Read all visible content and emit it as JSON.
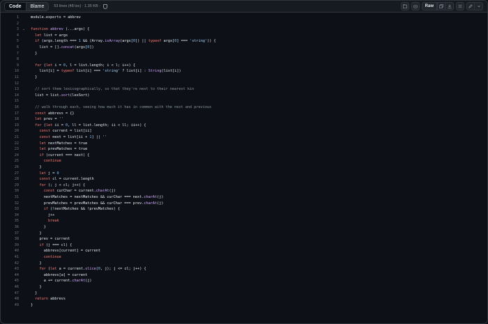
{
  "toolbar": {
    "tab_code": "Code",
    "tab_blame": "Blame",
    "file_info": "53 lines (48 loc) · 1.35 KB ·",
    "raw_label": "Raw"
  },
  "colors": {
    "background": "#0d1117",
    "keyword": "#ff7b72",
    "function": "#d2a8ff",
    "string": "#a5d6ff",
    "number": "#79c0ff",
    "comment": "#8b949e"
  },
  "icons": [
    "shield-icon",
    "copy-path-icon",
    "copilot-icon",
    "copy-icon",
    "download-icon",
    "list-icon",
    "pencil-icon",
    "chevron-down-icon",
    "chevron-fold-icon"
  ],
  "lines": [
    {
      "n": "1",
      "code": "module.exports = abbrev"
    },
    {
      "n": "2",
      "code": ""
    },
    {
      "n": "3",
      "code": "function abbrev (...args) {",
      "fold": true
    },
    {
      "n": "4",
      "code": "  let list = args"
    },
    {
      "n": "5",
      "code": "  if (args.length === 1 && (Array.isArray(args[0]) || typeof args[0] === 'string')) {"
    },
    {
      "n": "6",
      "code": "    list = [].concat(args[0])"
    },
    {
      "n": "7",
      "code": "  }"
    },
    {
      "n": "8",
      "code": ""
    },
    {
      "n": "9",
      "code": "  for (let i = 0, l = list.length; i < l; i++) {"
    },
    {
      "n": "10",
      "code": "    list[i] = typeof list[i] === 'string' ? list[i] : String(list[i])"
    },
    {
      "n": "11",
      "code": "  }"
    },
    {
      "n": "12",
      "code": ""
    },
    {
      "n": "13",
      "code": "  // sort them lexicographically, so that they're next to their nearest kin"
    },
    {
      "n": "14",
      "code": "  list = list.sort(lexSort)"
    },
    {
      "n": "15",
      "code": ""
    },
    {
      "n": "16",
      "code": "  // walk through each, seeing how much it has in common with the next and previous"
    },
    {
      "n": "17",
      "code": "  const abbrevs = {}"
    },
    {
      "n": "18",
      "code": "  let prev = ''"
    },
    {
      "n": "19",
      "code": "  for (let ii = 0, ll = list.length; ii < ll; ii++) {"
    },
    {
      "n": "20",
      "code": "    const current = list[ii]"
    },
    {
      "n": "21",
      "code": "    const next = list[ii + 1] || ''"
    },
    {
      "n": "22",
      "code": "    let nextMatches = true"
    },
    {
      "n": "23",
      "code": "    let prevMatches = true"
    },
    {
      "n": "24",
      "code": "    if (current === next) {"
    },
    {
      "n": "25",
      "code": "      continue"
    },
    {
      "n": "26",
      "code": "    }"
    },
    {
      "n": "27",
      "code": "    let j = 0"
    },
    {
      "n": "28",
      "code": "    const cl = current.length"
    },
    {
      "n": "29",
      "code": "    for (; j < cl; j++) {"
    },
    {
      "n": "30",
      "code": "      const curChar = current.charAt(j)"
    },
    {
      "n": "31",
      "code": "      nextMatches = nextMatches && curChar === next.charAt(j)"
    },
    {
      "n": "32",
      "code": "      prevMatches = prevMatches && curChar === prev.charAt(j)"
    },
    {
      "n": "33",
      "code": "      if (!nextMatches && !prevMatches) {"
    },
    {
      "n": "34",
      "code": "        j++"
    },
    {
      "n": "35",
      "code": "        break"
    },
    {
      "n": "36",
      "code": "      }"
    },
    {
      "n": "37",
      "code": "    }"
    },
    {
      "n": "38",
      "code": "    prev = current"
    },
    {
      "n": "39",
      "code": "    if (j === cl) {"
    },
    {
      "n": "40",
      "code": "      abbrevs[current] = current"
    },
    {
      "n": "41",
      "code": "      continue"
    },
    {
      "n": "42",
      "code": "    }"
    },
    {
      "n": "43",
      "code": "    for (let a = current.slice(0, j); j <= cl; j++) {"
    },
    {
      "n": "44",
      "code": "      abbrevs[a] = current"
    },
    {
      "n": "45",
      "code": "      a += current.charAt(j)"
    },
    {
      "n": "46",
      "code": "    }"
    },
    {
      "n": "47",
      "code": "  }"
    },
    {
      "n": "48",
      "code": "  return abbrevs"
    },
    {
      "n": "49",
      "code": "}"
    }
  ]
}
